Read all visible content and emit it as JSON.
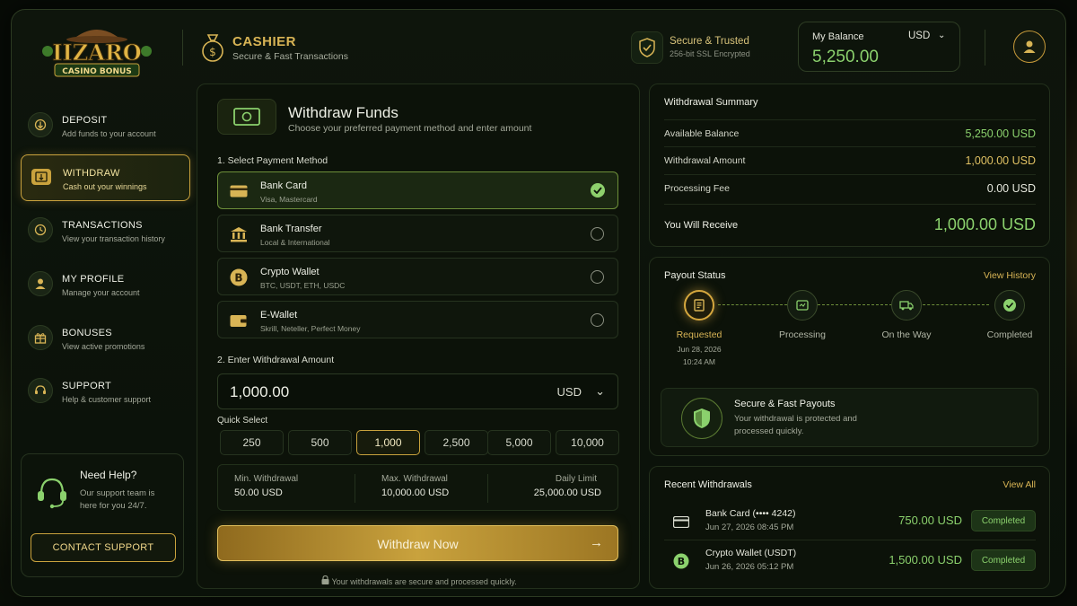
{
  "logo": {
    "line1": "IIZARO",
    "line2": "CASINO BONUS"
  },
  "header": {
    "title": "CASHIER",
    "subtitle": "Secure & Fast Transactions",
    "secure_title": "Secure & Trusted",
    "secure_sub": "256-bit SSL Encrypted",
    "balance_label": "My Balance",
    "balance_currency": "USD",
    "balance_value": "5,250.00"
  },
  "sidebar": {
    "items": [
      {
        "title": "DEPOSIT",
        "sub": "Add funds to your account"
      },
      {
        "title": "WITHDRAW",
        "sub": "Cash out your winnings"
      },
      {
        "title": "TRANSACTIONS",
        "sub": "View your transaction history"
      },
      {
        "title": "MY PROFILE",
        "sub": "Manage your account"
      },
      {
        "title": "BONUSES",
        "sub": "View active promotions"
      },
      {
        "title": "SUPPORT",
        "sub": "Help & customer support"
      }
    ],
    "active_index": 1,
    "help_title": "Need Help?",
    "help_text": "Our support team is here for you 24/7.",
    "contact_label": "CONTACT SUPPORT"
  },
  "withdraw": {
    "title": "Withdraw Funds",
    "subtitle": "Choose your preferred payment method and enter amount",
    "step1_label": "1. Select Payment Method",
    "methods": [
      {
        "title": "Bank Card",
        "sub": "Visa, Mastercard",
        "selected": true
      },
      {
        "title": "Bank Transfer",
        "sub": "Local & International",
        "selected": false
      },
      {
        "title": "Crypto Wallet",
        "sub": "BTC, USDT, ETH, USDC",
        "selected": false
      },
      {
        "title": "E-Wallet",
        "sub": "Skrill, Neteller, Perfect Money",
        "selected": false
      }
    ],
    "step2_label": "2. Enter Withdrawal Amount",
    "amount_value": "1,000.00",
    "amount_currency": "USD",
    "quick_select_label": "Quick Select",
    "quick_values": [
      "250",
      "500",
      "1,000",
      "2,500",
      "5,000",
      "10,000"
    ],
    "quick_selected": "1,000",
    "limits": [
      {
        "label": "Min. Withdrawal",
        "value": "50.00 USD"
      },
      {
        "label": "Max. Withdrawal",
        "value": "10,000.00 USD"
      },
      {
        "label": "Daily Limit",
        "value": "25,000.00 USD"
      }
    ],
    "submit_label": "Withdraw Now",
    "secure_note": "Your withdrawals are secure and processed quickly."
  },
  "summary": {
    "title": "Withdrawal Summary",
    "rows": [
      {
        "label": "Available Balance",
        "value": "5,250.00 USD"
      },
      {
        "label": "Withdrawal Amount",
        "value": "1,000.00 USD"
      },
      {
        "label": "Processing Fee",
        "value": "0.00 USD"
      },
      {
        "label": "You Will Receive",
        "value": "1,000.00 USD"
      }
    ]
  },
  "payout": {
    "title": "Payout Status",
    "link": "View History",
    "steps": [
      {
        "label": "Requested",
        "date": "Jun 28, 2026",
        "time": "10:24 AM"
      },
      {
        "label": "Processing"
      },
      {
        "label": "On the Way"
      },
      {
        "label": "Completed"
      }
    ],
    "info_title": "Secure & Fast Payouts",
    "info_text": "Your withdrawal is protected and processed quickly."
  },
  "recent": {
    "title": "Recent Withdrawals",
    "link": "View All",
    "items": [
      {
        "title": "Bank Card (•••• 4242)",
        "date": "Jun 27, 2026   08:45 PM",
        "amount": "750.00 USD",
        "status": "Completed"
      },
      {
        "title": "Crypto Wallet (USDT)",
        "date": "Jun 26, 2026   05:12 PM",
        "amount": "1,500.00 USD",
        "status": "Completed"
      }
    ]
  },
  "colors": {
    "accent_gold": "#c9a23d",
    "accent_green": "#8bd16d",
    "background": "#0c1209"
  }
}
